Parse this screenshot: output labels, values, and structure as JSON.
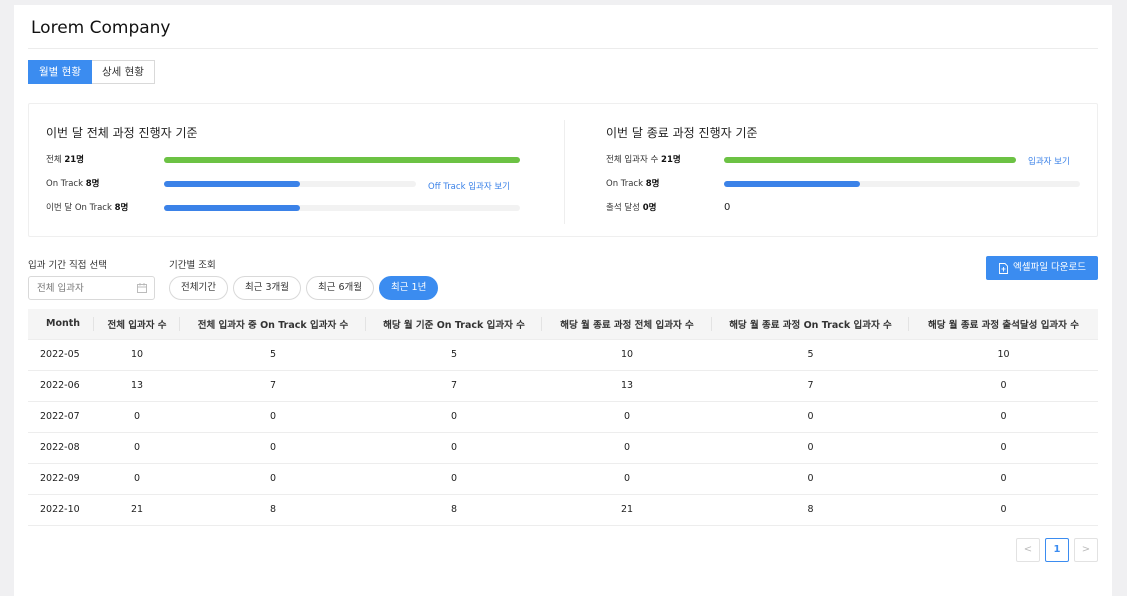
{
  "header": {
    "company": "Lorem Company"
  },
  "tabs": [
    {
      "label": "월별 현황",
      "active": true
    },
    {
      "label": "상세 현황",
      "active": false
    }
  ],
  "summary": {
    "left": {
      "title": "이번 달 전체 과정 진행자 기준",
      "rows": [
        {
          "label": "전체",
          "value": "21명",
          "progress": 1.0,
          "color": "#6cc244"
        },
        {
          "label": "On Track",
          "value": "8명",
          "progress": 0.381,
          "color": "#3b82e8",
          "link": "Off Track 입과자 보기"
        },
        {
          "label": "이번 달 On Track",
          "value": "8명",
          "progress": 0.381,
          "color": "#3b82e8"
        }
      ]
    },
    "right": {
      "title": "이번 달 종료 과정 진행자 기준",
      "rows": [
        {
          "label": "전체 입과자 수",
          "value": "21명",
          "progress": 1.0,
          "color": "#6cc244",
          "link": "입과자 보기"
        },
        {
          "label": "On Track",
          "value": "8명",
          "progress": 0.381,
          "color": "#3b82e8"
        },
        {
          "label": "출석 달성",
          "value": "0명",
          "plain": "0"
        }
      ]
    }
  },
  "filters": {
    "date_label": "입과 기간 직접 선택",
    "date_placeholder": "전체 입과자",
    "period_label": "기간별 조회",
    "periods": [
      {
        "label": "전체기간",
        "active": false
      },
      {
        "label": "최근 3개월",
        "active": false
      },
      {
        "label": "최근 6개월",
        "active": false
      },
      {
        "label": "최근 1년",
        "active": true
      }
    ],
    "excel_label": "엑셀파일 다운로드"
  },
  "table": {
    "columns": [
      "Month",
      "전체 입과자 수",
      "전체 입과자 중 On Track 입과자 수",
      "해당 월 기준 On Track 입과자 수",
      "해당 월 종료 과정 전체 입과자 수",
      "해당 월 종료 과정 On Track 입과자 수",
      "해당 월 종료 과정 출석달성 입과자 수"
    ],
    "rows": [
      [
        "2022-05",
        "10",
        "5",
        "5",
        "10",
        "5",
        "10"
      ],
      [
        "2022-06",
        "13",
        "7",
        "7",
        "13",
        "7",
        "0"
      ],
      [
        "2022-07",
        "0",
        "0",
        "0",
        "0",
        "0",
        "0"
      ],
      [
        "2022-08",
        "0",
        "0",
        "0",
        "0",
        "0",
        "0"
      ],
      [
        "2022-09",
        "0",
        "0",
        "0",
        "0",
        "0",
        "0"
      ],
      [
        "2022-10",
        "21",
        "8",
        "8",
        "21",
        "8",
        "0"
      ]
    ]
  },
  "pagination": {
    "prev": "<",
    "current": "1",
    "next": ">"
  }
}
